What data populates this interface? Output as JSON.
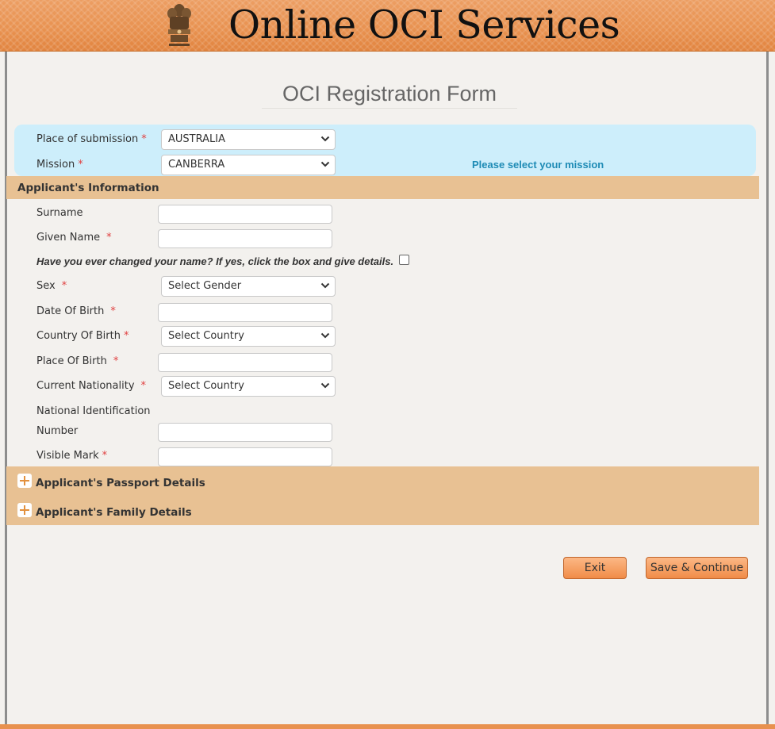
{
  "header": {
    "site_title": "Online OCI Services",
    "emblem_icon": "national-emblem-icon"
  },
  "form": {
    "title": "OCI Registration Form"
  },
  "submission": {
    "place_label": "Place of submission",
    "place_value": "AUSTRALIA",
    "mission_label": "Mission",
    "mission_value": "CANBERRA",
    "mission_hint": "Please select your mission"
  },
  "applicant": {
    "section_title": "Applicant's Information",
    "surname_label": "Surname",
    "surname_value": "",
    "given_name_label": "Given Name",
    "given_name_value": "",
    "name_change_question": "Have you ever changed your name? If yes, click the box and give details.",
    "sex_label": "Sex",
    "sex_value": "Select Gender",
    "dob_label": "Date Of Birth",
    "dob_value": "",
    "country_of_birth_label": "Country Of Birth",
    "country_of_birth_value": "Select Country",
    "place_of_birth_label": "Place Of Birth",
    "place_of_birth_value": "",
    "nationality_label": "Current Nationality",
    "nationality_value": "Select Country",
    "national_id_label_line1": "National Identification",
    "national_id_label_line2": "Number",
    "national_id_value": "",
    "visible_mark_label": "Visible Mark",
    "visible_mark_value": ""
  },
  "required_marker": "*",
  "sections": {
    "passport_title": "Applicant's Passport Details",
    "family_title": "Applicant's Family Details",
    "expand_icon": "plus-icon"
  },
  "buttons": {
    "exit": "Exit",
    "save_continue": "Save & Continue"
  },
  "colors": {
    "header_orange": "#e8914f",
    "section_tan": "#e8c193",
    "mission_blue": "#cdeefb",
    "hint_blue": "#1e8bb5",
    "required_red": "#e04040"
  }
}
